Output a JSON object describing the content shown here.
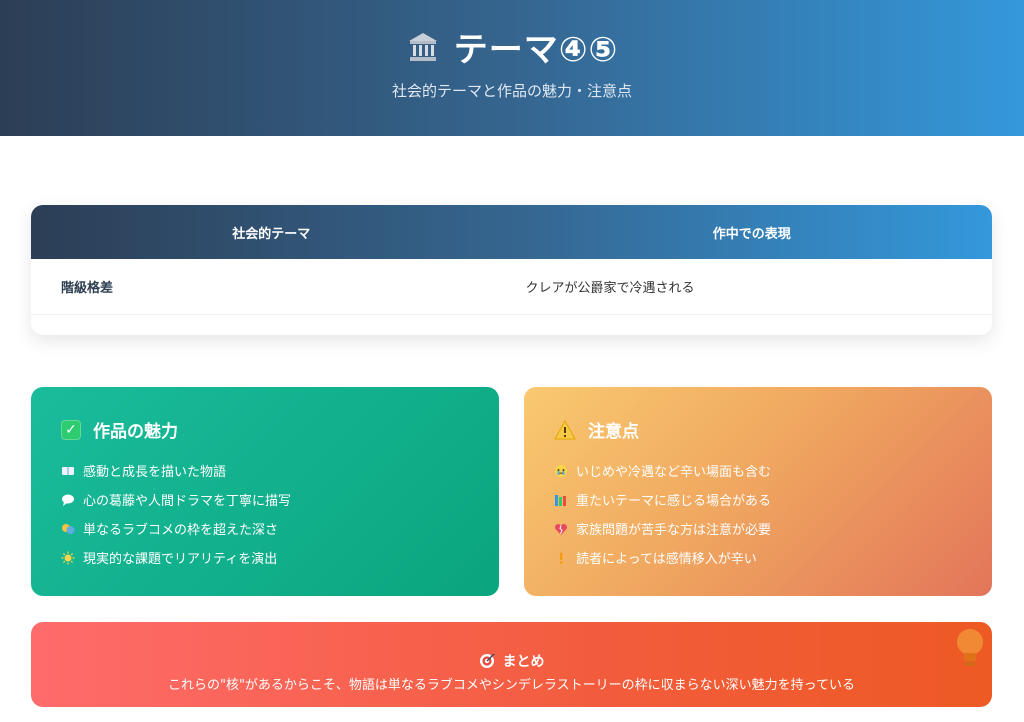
{
  "header": {
    "icon": "bank-icon",
    "title": "テーマ④⑤",
    "subtitle": "社会的テーマと作品の魅力・注意点"
  },
  "table": {
    "columns": [
      "社会的テーマ",
      "作中での表現"
    ],
    "rows": [
      {
        "theme": "階級格差",
        "expression": "クレアが公爵家で冷遇される"
      }
    ]
  },
  "charm": {
    "icon": "check-icon",
    "title": "作品の魅力",
    "color": "#1abc9c",
    "items": [
      {
        "icon": "book-icon",
        "text": "感動と成長を描いた物語"
      },
      {
        "icon": "speech-bubble-icon",
        "text": "心の葛藤や人間ドラマを丁寧に描写"
      },
      {
        "icon": "theater-masks-icon",
        "text": "単なるラブコメの枠を超えた深さ"
      },
      {
        "icon": "sun-icon",
        "text": "現実的な課題でリアリティを演出"
      }
    ]
  },
  "caution": {
    "icon": "warning-icon",
    "title": "注意点",
    "color": "#f0a860",
    "items": [
      {
        "icon": "crying-face-icon",
        "text": "いじめや冷遇など辛い場面も含む"
      },
      {
        "icon": "books-icon",
        "text": "重たいテーマに感じる場合がある"
      },
      {
        "icon": "broken-heart-icon",
        "text": "家族問題が苦手な方は注意が必要"
      },
      {
        "icon": "exclamation-icon",
        "text": "読者によっては感情移入が辛い"
      }
    ]
  },
  "summary": {
    "icon": "target-icon",
    "title": "まとめ",
    "text": "これらの\"核\"があるからこそ、物語は単なるラブコメやシンデレラストーリーの枠に収まらない深い魅力を持っている",
    "decoration": "lightbulb-icon"
  }
}
